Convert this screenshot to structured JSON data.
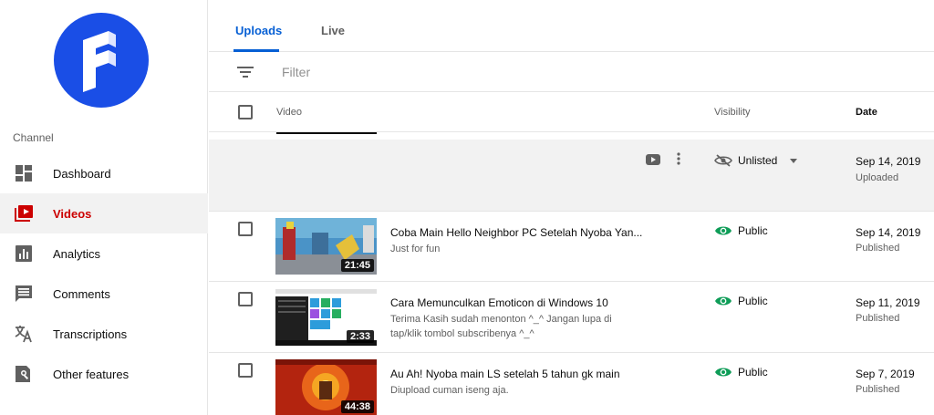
{
  "sidebar": {
    "section_label": "Channel",
    "items": [
      {
        "label": "Dashboard",
        "icon": "dashboard-icon"
      },
      {
        "label": "Videos",
        "icon": "videos-icon",
        "active": true
      },
      {
        "label": "Analytics",
        "icon": "analytics-icon"
      },
      {
        "label": "Comments",
        "icon": "comments-icon"
      },
      {
        "label": "Transcriptions",
        "icon": "translate-icon"
      },
      {
        "label": "Other features",
        "icon": "other-features-icon"
      }
    ]
  },
  "tabs": {
    "uploads": "Uploads",
    "live": "Live"
  },
  "filter": {
    "placeholder": "Filter"
  },
  "table": {
    "headers": {
      "video": "Video",
      "visibility": "Visibility",
      "date": "Date"
    },
    "rows": [
      {
        "title": "",
        "description": "",
        "duration": "",
        "visibility": "Unlisted",
        "date": "Sep 14, 2019",
        "status": "Uploaded"
      },
      {
        "title": "Coba Main Hello Neighbor PC Setelah Nyoba Yan...",
        "description": "Just for fun",
        "duration": "21:45",
        "visibility": "Public",
        "date": "Sep 14, 2019",
        "status": "Published"
      },
      {
        "title": "Cara Memunculkan Emoticon di Windows 10",
        "description": "Terima Kasih sudah menonton ^_^ Jangan lupa di tap/klik tombol subscribenya ^_^",
        "duration": "2:33",
        "visibility": "Public",
        "date": "Sep 11, 2019",
        "status": "Published"
      },
      {
        "title": "Au Ah! Nyoba main LS setelah 5 tahun gk main",
        "description": "Diupload cuman iseng aja.",
        "duration": "44:38",
        "visibility": "Public",
        "date": "Sep 7, 2019",
        "status": "Published"
      }
    ]
  },
  "colors": {
    "accent": "#065fd4",
    "active_nav": "#cc0000",
    "public_eye": "#0f9d58",
    "logo_bg": "#1a4ee6"
  }
}
